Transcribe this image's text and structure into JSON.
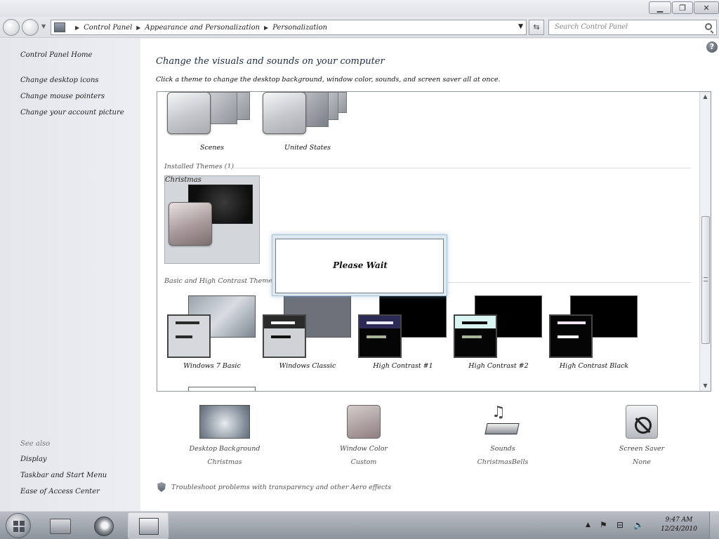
{
  "window": {
    "minimize_glyph": "▁",
    "maximize_glyph": "❐",
    "close_glyph": "✕"
  },
  "nav": {
    "breadcrumb": [
      "Control Panel",
      "Appearance and Personalization",
      "Personalization"
    ],
    "breadcrumb_sep": "▶",
    "dropdown_glyph": "▼",
    "refresh_glyph": "⇆",
    "search_placeholder": "Search Control Panel"
  },
  "sidebar": {
    "home": "Control Panel Home",
    "links": [
      "Change desktop icons",
      "Change mouse pointers",
      "Change your account picture"
    ],
    "see_also_title": "See also",
    "see_also": [
      "Display",
      "Taskbar and Start Menu",
      "Ease of Access Center"
    ]
  },
  "main": {
    "help_glyph": "?",
    "heading": "Change the visuals and sounds on your computer",
    "subheading": "Click a theme to change the desktop background, window color, sounds, and screen saver all at once.",
    "my_themes": [
      {
        "name": "Scenes"
      },
      {
        "name": "United States"
      }
    ],
    "installed_title": "Installed Themes (1)",
    "installed_themes": [
      {
        "name": "Christmas"
      }
    ],
    "basic_title": "Basic and High Contrast Themes (6)",
    "basic_themes": [
      {
        "name": "Windows 7 Basic",
        "wall": "#7f8a97",
        "win_bg": "#d6d8dc",
        "title_bar": "#2a2a2a",
        "text_bar": "#2a2a2a"
      },
      {
        "name": "Windows Classic",
        "wall": "#6c717a",
        "win_bg": "#d0d2d6",
        "title_bar": "#ffffff",
        "text_bar": "#111111"
      },
      {
        "name": "High Contrast #1",
        "wall": "#000000",
        "win_bg": "#050505",
        "title_bar": "#e8e8ff",
        "text_bar": "#a9b49a"
      },
      {
        "name": "High Contrast #2",
        "wall": "#000000",
        "win_bg": "#050505",
        "title_bar": "#d8f5f2",
        "text_bar": "#a9b49a"
      },
      {
        "name": "High Contrast Black",
        "wall": "#000000",
        "win_bg": "#050505",
        "title_bar": "#f2e3f5",
        "text_bar": "#ffffff"
      }
    ],
    "dialog_text": "Please Wait"
  },
  "settings": [
    {
      "label": "Desktop Background",
      "value": "Christmas"
    },
    {
      "label": "Window Color",
      "value": "Custom"
    },
    {
      "label": "Sounds",
      "value": "ChristmasBells"
    },
    {
      "label": "Screen Saver",
      "value": "None"
    }
  ],
  "footnote": "Troubleshoot problems with transparency and other Aero effects",
  "taskbar": {
    "tray_glyphs": [
      "▲",
      "⚑",
      "⊟",
      "🔈"
    ],
    "clock_time": "9:47 AM",
    "clock_date": "12/24/2010"
  }
}
